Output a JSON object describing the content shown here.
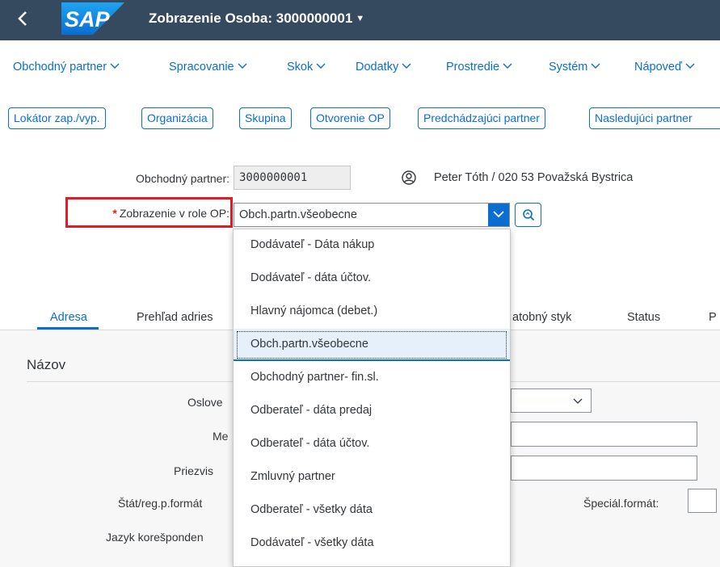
{
  "shell": {
    "back_icon": "chevron-left-icon",
    "logo_text": "SAP",
    "title": "Zobrazenie Osoba: 3000000001"
  },
  "menu": [
    {
      "label": "Obchodný partner"
    },
    {
      "label": "Spracovanie"
    },
    {
      "label": "Skok"
    },
    {
      "label": "Dodatky"
    },
    {
      "label": "Prostredie"
    },
    {
      "label": "Systém"
    },
    {
      "label": "Nápoveď"
    }
  ],
  "toolbar": [
    {
      "label": "Lokátor zap./vyp."
    },
    {
      "label": "Organizácia"
    },
    {
      "label": "Skupina"
    },
    {
      "label": "Otvorenie OP"
    },
    {
      "label": "Predchádzajúci partner"
    },
    {
      "label": "Nasledujúci partner"
    }
  ],
  "header": {
    "partner_label": "Obchodný partner:",
    "partner_value": "3000000001",
    "person_icon": "person-icon",
    "person_text": "Peter Tóth / 020 53 Považská Bystrica",
    "role_required": "*",
    "role_label": "Zobrazenie v role OP:",
    "role_value": "Obch.partn.všeobecne",
    "search_icon": "value-help-icon"
  },
  "tabs": [
    {
      "label": "Adresa",
      "active": true
    },
    {
      "label": "Prehľad adries"
    },
    {
      "label": "atobný styk"
    },
    {
      "label": "Status"
    },
    {
      "label": "P"
    }
  ],
  "panel": {
    "title": "Názov",
    "labels": {
      "oslovenie": "Oslove",
      "meno": "Me",
      "priezvisko": "Priezvis",
      "stat": "Štát/reg.p.formát",
      "jazyk": "Jazyk korešponden",
      "special": "Špeciál.formát:"
    }
  },
  "dropdown": {
    "items": [
      "Dodávateľ - Dáta nákup",
      "Dodávateľ - dáta účtov.",
      "Hlavný nájomca (debet.)",
      "Obch.partn.všeobecne",
      "Obchodný partner- fin.sl.",
      "Odberateľ - dáta predaj",
      "Odberateľ - dáta účtov.",
      "Zmluvný partner",
      "Odberateľ - všetky dáta",
      "Dodávateľ - všetky dáta"
    ],
    "selected_index": 3
  },
  "colors": {
    "shell": "#354a5f",
    "accent": "#0a6ed1",
    "highlight_box": "#e41b23"
  }
}
